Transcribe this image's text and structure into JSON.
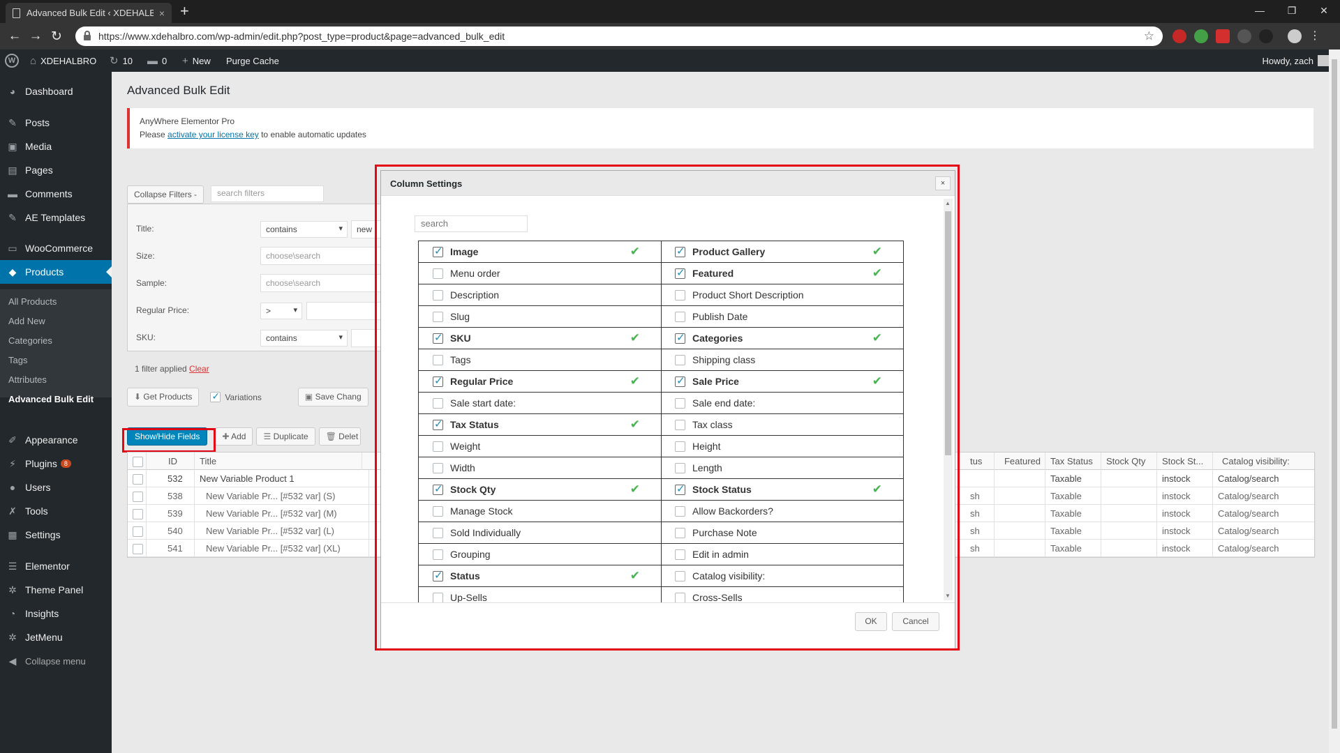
{
  "browser": {
    "tab_title": "Advanced Bulk Edit ‹ XDEHALBRO",
    "tab_close": "×",
    "new_tab": "+",
    "url": "https://www.xdehalbro.com/wp-admin/edit.php?post_type=product&page=advanced_bulk_edit",
    "window_controls": [
      "—",
      "❐",
      "✕"
    ]
  },
  "adminbar": {
    "site_name": "XDEHALBRO",
    "updates_count": "10",
    "comments_count": "0",
    "new_label": "New",
    "purge_label": "Purge Cache",
    "howdy": "Howdy, zach"
  },
  "sidebar": {
    "items": [
      {
        "label": "Dashboard",
        "icon": "dashboard-icon",
        "glyph": "◕"
      },
      {
        "label": "Posts",
        "icon": "pin-icon",
        "glyph": "✎"
      },
      {
        "label": "Media",
        "icon": "media-icon",
        "glyph": "▣"
      },
      {
        "label": "Pages",
        "icon": "page-icon",
        "glyph": "▤"
      },
      {
        "label": "Comments",
        "icon": "comment-icon",
        "glyph": "▬"
      },
      {
        "label": "AE Templates",
        "icon": "pin-icon",
        "glyph": "✎"
      },
      {
        "label": "WooCommerce",
        "icon": "woo-icon",
        "glyph": "▭"
      },
      {
        "label": "Products",
        "icon": "box-icon",
        "glyph": "◆"
      },
      {
        "label": "Appearance",
        "icon": "brush-icon",
        "glyph": "✐"
      },
      {
        "label": "Plugins",
        "icon": "plug-icon",
        "glyph": "⚡"
      },
      {
        "label": "Users",
        "icon": "user-icon",
        "glyph": "●"
      },
      {
        "label": "Tools",
        "icon": "wrench-icon",
        "glyph": "✗"
      },
      {
        "label": "Settings",
        "icon": "settings-icon",
        "glyph": "▦"
      },
      {
        "label": "Elementor",
        "icon": "elementor-icon",
        "glyph": "☰"
      },
      {
        "label": "Theme Panel",
        "icon": "gear-icon",
        "glyph": "✲"
      },
      {
        "label": "Insights",
        "icon": "insights-icon",
        "glyph": "◔"
      },
      {
        "label": "JetMenu",
        "icon": "gear-icon",
        "glyph": "✲"
      },
      {
        "label": "Collapse menu",
        "icon": "collapse-icon",
        "glyph": "◀"
      }
    ],
    "plugins_badge": "8",
    "submenu": [
      "All Products",
      "Add New",
      "Categories",
      "Tags",
      "Attributes",
      "Advanced Bulk Edit"
    ]
  },
  "page": {
    "title": "Advanced Bulk Edit",
    "notice_title": "AnyWhere Elementor Pro",
    "notice_pre": "Please ",
    "notice_link": "activate your license key",
    "notice_post": " to enable automatic updates"
  },
  "filters": {
    "collapse_label": "Collapse Filters -",
    "search_placeholder": "search filters",
    "title_label": "Title:",
    "title_op": "contains",
    "title_value": "new",
    "size_label": "Size:",
    "size_placeholder": "choose\\search",
    "sample_label": "Sample:",
    "sample_placeholder": "choose\\search",
    "price_label": "Regular Price:",
    "price_op": ">",
    "sku_label": "SKU:",
    "sku_op": "contains",
    "applied_text": "1 filter applied ",
    "clear_label": "Clear"
  },
  "actions": {
    "get_products": "Get Products",
    "variations": "Variations",
    "save_changes": "Save Chang",
    "show_hide": "Show/Hide Fields",
    "add": "Add",
    "duplicate": "Duplicate",
    "delete": "Delet"
  },
  "table": {
    "head": {
      "id": "ID",
      "title": "Title",
      "status": "tus",
      "featured": "Featured",
      "tax": "Tax Status",
      "stock_qty": "Stock Qty",
      "stock_status": "Stock St...",
      "catalog": "Catalog visibility:"
    },
    "rows": [
      {
        "id": "532",
        "title": "New Variable Product 1",
        "status": "",
        "tax": "Taxable",
        "stock": "instock",
        "catalog": "Catalog/search"
      },
      {
        "id": "538",
        "title": "New Variable Pr... [#532 var] (S)",
        "status": "sh",
        "tax": "Taxable",
        "stock": "instock",
        "catalog": "Catalog/search"
      },
      {
        "id": "539",
        "title": "New Variable Pr... [#532 var] (M)",
        "status": "sh",
        "tax": "Taxable",
        "stock": "instock",
        "catalog": "Catalog/search"
      },
      {
        "id": "540",
        "title": "New Variable Pr... [#532 var] (L)",
        "status": "sh",
        "tax": "Taxable",
        "stock": "instock",
        "catalog": "Catalog/search"
      },
      {
        "id": "541",
        "title": "New Variable Pr... [#532 var] (XL)",
        "status": "sh",
        "tax": "Taxable",
        "stock": "instock",
        "catalog": "Catalog/search"
      }
    ]
  },
  "modal": {
    "title": "Column Settings",
    "close": "×",
    "search_placeholder": "search",
    "ok": "OK",
    "cancel": "Cancel",
    "columns": [
      [
        {
          "label": "Image",
          "checked": true
        },
        {
          "label": "Product Gallery",
          "checked": true
        }
      ],
      [
        {
          "label": "Menu order",
          "checked": false
        },
        {
          "label": "Featured",
          "checked": true
        }
      ],
      [
        {
          "label": "Description",
          "checked": false
        },
        {
          "label": "Product Short Description",
          "checked": false
        }
      ],
      [
        {
          "label": "Slug",
          "checked": false
        },
        {
          "label": "Publish Date",
          "checked": false
        }
      ],
      [
        {
          "label": "SKU",
          "checked": true
        },
        {
          "label": "Categories",
          "checked": true
        }
      ],
      [
        {
          "label": "Tags",
          "checked": false
        },
        {
          "label": "Shipping class",
          "checked": false
        }
      ],
      [
        {
          "label": "Regular Price",
          "checked": true
        },
        {
          "label": "Sale Price",
          "checked": true
        }
      ],
      [
        {
          "label": "Sale start date:",
          "checked": false
        },
        {
          "label": "Sale end date:",
          "checked": false
        }
      ],
      [
        {
          "label": "Tax Status",
          "checked": true
        },
        {
          "label": "Tax class",
          "checked": false
        }
      ],
      [
        {
          "label": "Weight",
          "checked": false
        },
        {
          "label": "Height",
          "checked": false
        }
      ],
      [
        {
          "label": "Width",
          "checked": false
        },
        {
          "label": "Length",
          "checked": false
        }
      ],
      [
        {
          "label": "Stock Qty",
          "checked": true
        },
        {
          "label": "Stock Status",
          "checked": true
        }
      ],
      [
        {
          "label": "Manage Stock",
          "checked": false
        },
        {
          "label": "Allow Backorders?",
          "checked": false
        }
      ],
      [
        {
          "label": "Sold Individually",
          "checked": false
        },
        {
          "label": "Purchase Note",
          "checked": false
        }
      ],
      [
        {
          "label": "Grouping",
          "checked": false
        },
        {
          "label": "Edit in admin",
          "checked": false
        }
      ],
      [
        {
          "label": "Status",
          "checked": true
        },
        {
          "label": "Catalog visibility:",
          "checked": false
        }
      ],
      [
        {
          "label": "Up-Sells",
          "checked": false
        },
        {
          "label": "Cross-Sells",
          "checked": false
        }
      ]
    ]
  },
  "colors": {
    "highlight": "#e30613",
    "wp_blue": "#0073aa",
    "check_green": "#46b450"
  }
}
